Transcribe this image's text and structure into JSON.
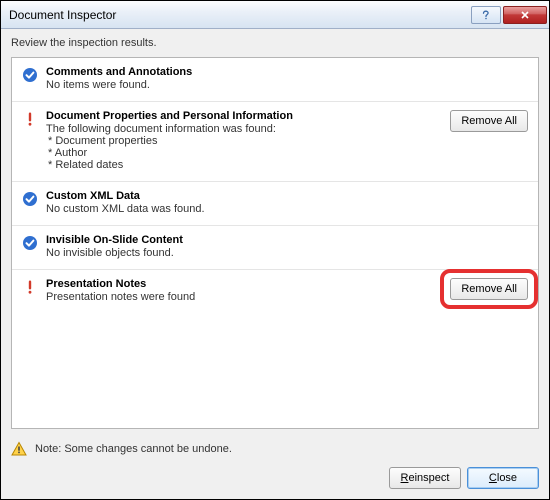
{
  "window": {
    "title": "Document Inspector",
    "instruction": "Review the inspection results."
  },
  "sections": [
    {
      "status": "ok",
      "title": "Comments and Annotations",
      "desc": "No items were found.",
      "details": [],
      "action": null
    },
    {
      "status": "warn",
      "title": "Document Properties and Personal Information",
      "desc": "The following document information was found:",
      "details": [
        "* Document properties",
        "* Author",
        "* Related dates"
      ],
      "action": "Remove All"
    },
    {
      "status": "ok",
      "title": "Custom XML Data",
      "desc": "No custom XML data was found.",
      "details": [],
      "action": null
    },
    {
      "status": "ok",
      "title": "Invisible On-Slide Content",
      "desc": "No invisible objects found.",
      "details": [],
      "action": null
    },
    {
      "status": "warn",
      "title": "Presentation Notes",
      "desc": "Presentation notes were found",
      "details": [],
      "action": "Remove All"
    }
  ],
  "footer": {
    "note": "Note: Some changes cannot be undone.",
    "reinspect_label": "Reinspect",
    "close_label": "Close"
  },
  "highlight_section_index": 4
}
